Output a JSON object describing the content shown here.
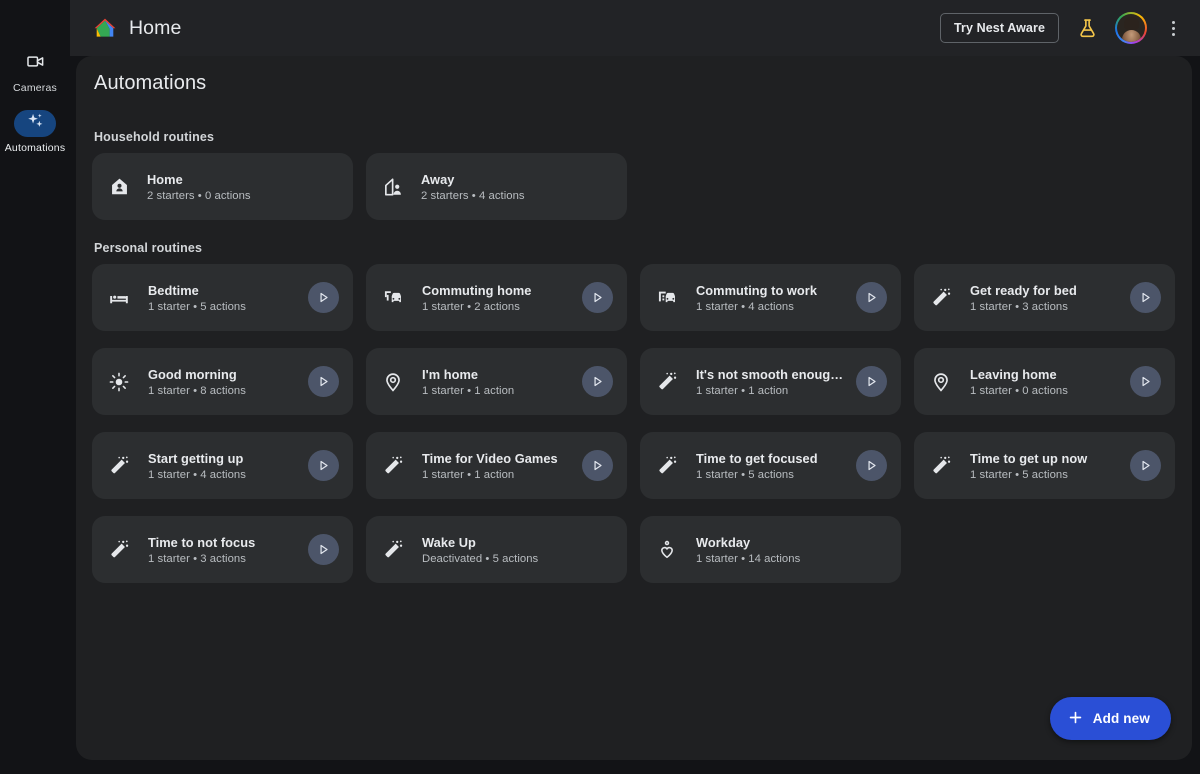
{
  "app": {
    "title": "Home",
    "logo_icon": "google-home-logo"
  },
  "topbar": {
    "nest_aware_label": "Try Nest Aware",
    "flask_icon": "flask-icon",
    "avatar_icon": "user-avatar",
    "menu_icon": "kebab-menu-icon",
    "accent_blue": "#2a4fd6"
  },
  "sidebar": {
    "items": [
      {
        "label": "Cameras",
        "icon": "video-camera-icon",
        "active": false
      },
      {
        "label": "Automations",
        "icon": "sparkles-icon",
        "active": true
      }
    ]
  },
  "main": {
    "page_title": "Automations",
    "sections": [
      {
        "label": "Household routines",
        "cards": [
          {
            "name": "Home",
            "sub": "2 starters • 0 actions",
            "icon": "house-filled-icon",
            "has_play": false
          },
          {
            "name": "Away",
            "sub": "2 starters • 4 actions",
            "icon": "house-person-icon",
            "has_play": false
          }
        ]
      },
      {
        "label": "Personal routines",
        "cards": [
          {
            "name": "Bedtime",
            "sub": "1 starter • 5 actions",
            "icon": "bed-icon",
            "has_play": true
          },
          {
            "name": "Commuting home",
            "sub": "1 starter • 2 actions",
            "icon": "car-home-icon",
            "has_play": true
          },
          {
            "name": "Commuting to work",
            "sub": "1 starter • 4 actions",
            "icon": "car-work-icon",
            "has_play": true
          },
          {
            "name": "Get ready for bed",
            "sub": "1 starter • 3 actions",
            "icon": "magic-wand-icon",
            "has_play": true
          },
          {
            "name": "Good morning",
            "sub": "1 starter • 8 actions",
            "icon": "sun-icon",
            "has_play": true
          },
          {
            "name": "I'm home",
            "sub": "1 starter • 1 action",
            "icon": "location-pin-icon",
            "has_play": true
          },
          {
            "name": "It's not smooth enough in here",
            "sub": "1 starter • 1 action",
            "icon": "magic-wand-icon",
            "has_play": true
          },
          {
            "name": "Leaving home",
            "sub": "1 starter • 0 actions",
            "icon": "location-pin-icon",
            "has_play": true
          },
          {
            "name": "Start getting up",
            "sub": "1 starter • 4 actions",
            "icon": "magic-wand-icon",
            "has_play": true
          },
          {
            "name": "Time for Video Games",
            "sub": "1 starter • 1 action",
            "icon": "magic-wand-icon",
            "has_play": true
          },
          {
            "name": "Time to get focused",
            "sub": "1 starter • 5 actions",
            "icon": "magic-wand-icon",
            "has_play": true
          },
          {
            "name": "Time to get up now",
            "sub": "1 starter • 5 actions",
            "icon": "magic-wand-icon",
            "has_play": true
          },
          {
            "name": "Time to not focus",
            "sub": "1 starter • 3 actions",
            "icon": "magic-wand-icon",
            "has_play": true
          },
          {
            "name": "Wake Up",
            "sub": "Deactivated • 5 actions",
            "icon": "magic-wand-icon",
            "has_play": false
          },
          {
            "name": "Workday",
            "sub": "1 starter • 14 actions",
            "icon": "heart-routine-icon",
            "has_play": false
          }
        ]
      }
    ],
    "fab_label": "Add new",
    "fab_icon": "plus-icon"
  }
}
